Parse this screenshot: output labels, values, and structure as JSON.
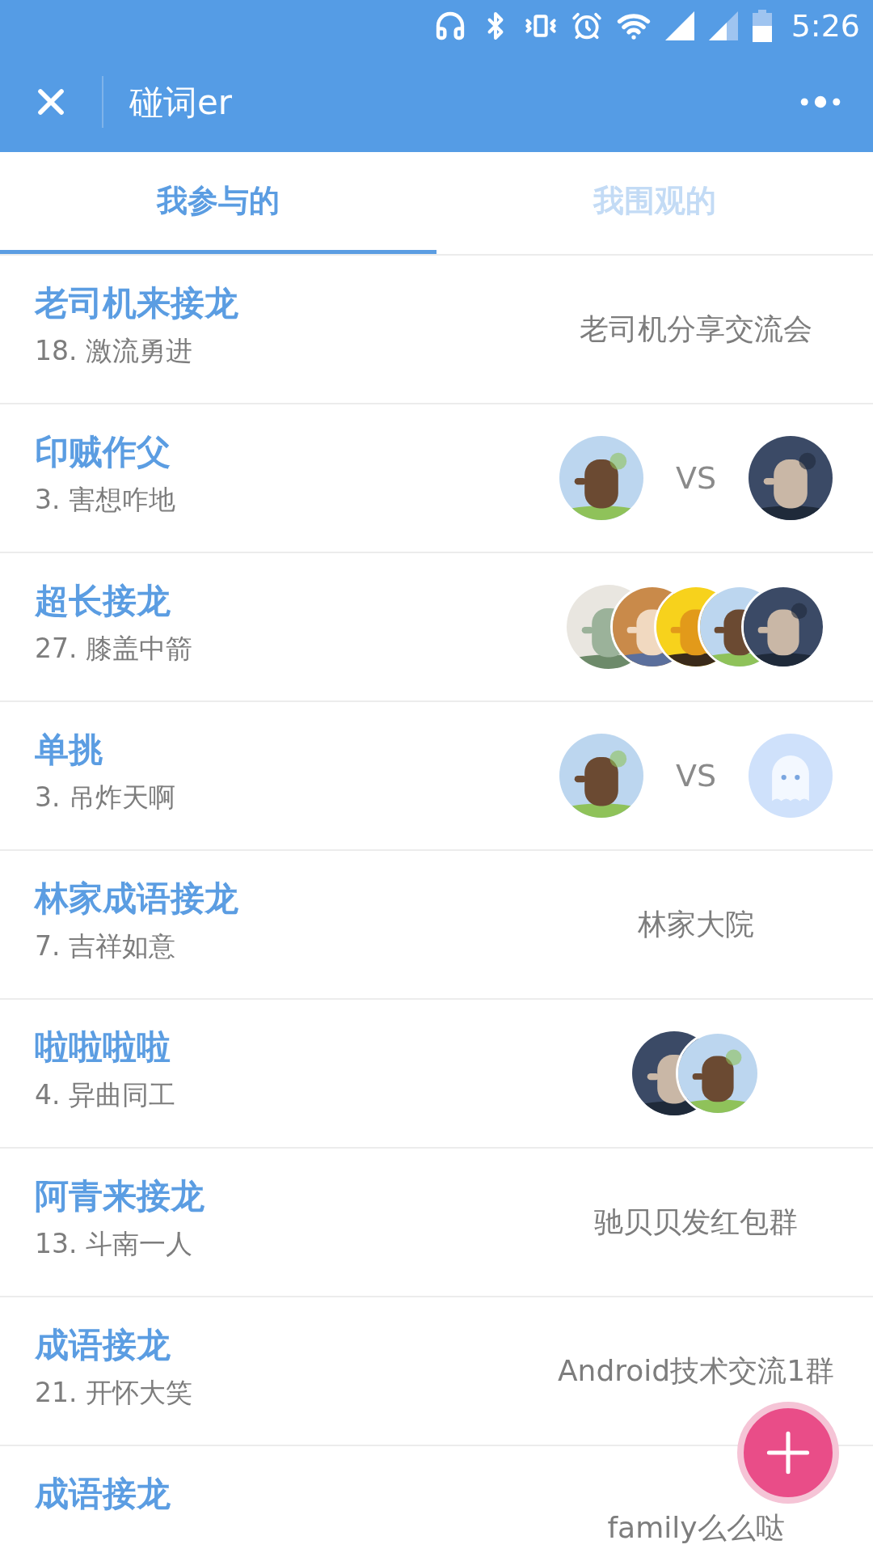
{
  "status_bar": {
    "time": "5:26"
  },
  "header": {
    "title": "碰词er"
  },
  "tabs": [
    {
      "label": "我参与的",
      "selected": true
    },
    {
      "label": "我围观的",
      "selected": false
    }
  ],
  "rows": [
    {
      "title": "老司机来接龙",
      "subtitle": "18. 激流勇进",
      "right": {
        "kind": "text",
        "text": "老司机分享交流会"
      }
    },
    {
      "title": "印贼作父",
      "subtitle": "3. 害想咋地",
      "right": {
        "kind": "versus",
        "label": "VS",
        "avatars": [
          {
            "kind": "picture"
          },
          {
            "kind": "picture"
          }
        ]
      }
    },
    {
      "title": "超长接龙",
      "subtitle": "27. 膝盖中箭",
      "right": {
        "kind": "group",
        "avatars": [
          {
            "kind": "picture"
          },
          {
            "kind": "picture"
          },
          {
            "kind": "picture"
          },
          {
            "kind": "picture"
          },
          {
            "kind": "picture"
          }
        ]
      }
    },
    {
      "title": "单挑",
      "subtitle": "3. 吊炸天啊",
      "right": {
        "kind": "versus",
        "label": "VS",
        "avatars": [
          {
            "kind": "picture"
          },
          {
            "kind": "default"
          }
        ]
      }
    },
    {
      "title": "林家成语接龙",
      "subtitle": "7. 吉祥如意",
      "right": {
        "kind": "text",
        "text": "林家大院"
      }
    },
    {
      "title": "啦啦啦啦",
      "subtitle": "4. 异曲同工",
      "right": {
        "kind": "group",
        "avatars": [
          {
            "kind": "picture"
          },
          {
            "kind": "picture"
          }
        ]
      }
    },
    {
      "title": "阿青来接龙",
      "subtitle": "13. 斗南一人",
      "right": {
        "kind": "text",
        "text": "驰贝贝发红包群"
      }
    },
    {
      "title": "成语接龙",
      "subtitle": "21. 开怀大笑",
      "right": {
        "kind": "text",
        "text": "Android技术交流1群"
      }
    },
    {
      "title": "成语接龙",
      "right": {
        "kind": "text",
        "text": "family么么哒"
      }
    }
  ]
}
